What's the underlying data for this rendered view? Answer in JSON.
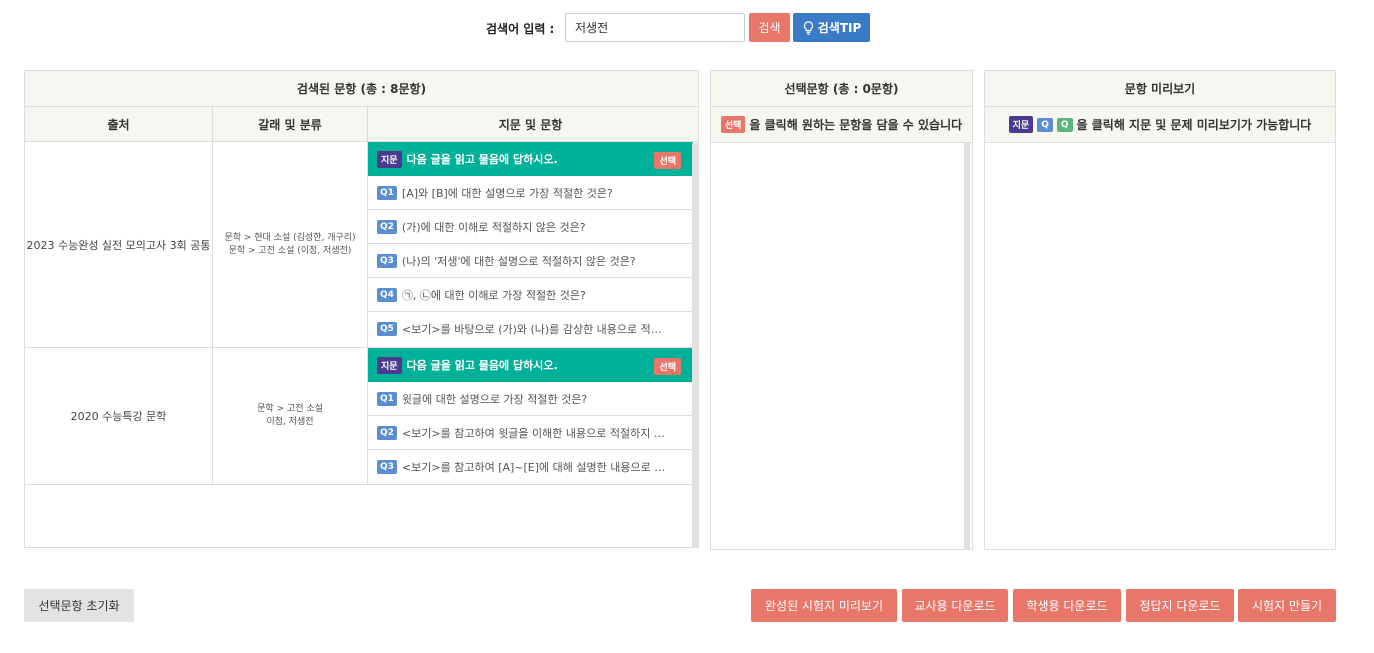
{
  "search": {
    "label": "검색어 입력 :",
    "value": "저생전",
    "search_button": "검색",
    "tip_button": "검색TIP"
  },
  "results_panel": {
    "title": "검색된 문항 (총 : 8문항)",
    "columns": [
      "출처",
      "갈래 및 분류",
      "지문 및 문항"
    ],
    "groups": [
      {
        "source": "2023 수능완성 실전 모의고사 3회 공통",
        "categories": [
          "문학 > 현대 소설 (김성한, 개구리)",
          "문학 > 고전 소설 (이정, 저생전)"
        ],
        "passage": {
          "tag": "지문",
          "text": "다음 글을 읽고 물음에 답하시오.",
          "select": "선택"
        },
        "questions": [
          {
            "tag": "Q1",
            "text": "[A]와 [B]에 대한 설명으로 가장 적절한 것은?"
          },
          {
            "tag": "Q2",
            "text": "(가)에 대한 이해로 적절하지 않은 것은?"
          },
          {
            "tag": "Q3",
            "text": "(나)의 '저생'에 대한 설명으로 적절하지 않은 것은?"
          },
          {
            "tag": "Q4",
            "text": "㉠, ㉡에 대한 이해로 가장 적절한 것은?"
          },
          {
            "tag": "Q5",
            "text": "<보기>를 바탕으로 (가)와 (나)를 감상한 내용으로 적…"
          }
        ]
      },
      {
        "source": "2020 수능특강 문학",
        "categories": [
          "문학 > 고전 소설",
          "이첨, 저생전"
        ],
        "passage": {
          "tag": "지문",
          "text": "다음 글을 읽고 물음에 답하시오.",
          "select": "선택"
        },
        "questions": [
          {
            "tag": "Q1",
            "text": "윗글에 대한 설명으로 가장 적절한 것은?"
          },
          {
            "tag": "Q2",
            "text": "<보기>를 참고하여 윗글을 이해한 내용으로 적절하지 …"
          },
          {
            "tag": "Q3",
            "text": "<보기>를 참고하여 [A]~[E]에 대해 설명한 내용으로 …"
          }
        ]
      }
    ]
  },
  "selected_panel": {
    "title": "선택문항 (총 : 0문항)",
    "hint_tag": "선택",
    "hint_text": "을 클릭해 원하는 문항을 담을 수 있습니다"
  },
  "preview_panel": {
    "title": "문항 미리보기",
    "hint_tags": [
      "지문",
      "Q",
      "Q"
    ],
    "hint_text": "을 클릭해 지문 및 문제 미리보기가 가능합니다"
  },
  "bottom": {
    "reset": "선택문항 초기화",
    "preview_exam": "완성된 시험지 미리보기",
    "teacher_download": "교사용 다운로드",
    "student_download": "학생용 다운로드",
    "answer_download": "정답지 다운로드",
    "make_exam": "시험지 만들기"
  },
  "colors": {
    "accent_red": "#e8776a",
    "tip_blue": "#3a7bc8",
    "passage_teal": "#00b19a",
    "jimun_purple": "#4a3b8f",
    "q_blue": "#5a8ed0",
    "q_green": "#5cb87a"
  }
}
